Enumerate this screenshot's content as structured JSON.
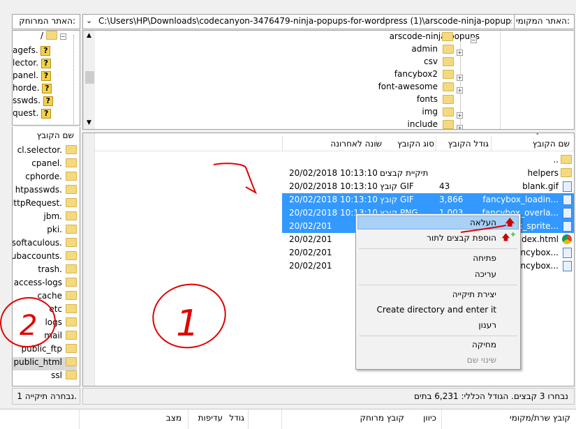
{
  "left_pathbar": {
    "label": "האתר המרוחק:"
  },
  "right_pathbar": {
    "label": "האתר המקומי:",
    "path": "C:\\Users\\HP\\Downloads\\codecanyon-3476479-ninja-popups-for-wordpress (1)\\arscode-ninja-popups\\fancybo",
    "dropdown_icon": "chevron-down-icon"
  },
  "remote_tree": {
    "root": "/",
    "items": [
      "agefs.",
      "lector.",
      "panel.",
      "horde.",
      "sswds.",
      "quest."
    ]
  },
  "local_tree": {
    "items": [
      "arscode-ninja-popups",
      "admin",
      "csv",
      "fancybox2",
      "font-awesome",
      "fonts",
      "img",
      "include"
    ]
  },
  "remote_list": {
    "header": "שם הקובץ",
    "items": [
      "cl.selector.",
      "cpanel.",
      "cphorde.",
      "htpasswds.",
      "HttpRequest.",
      "jbm.",
      "pki.",
      "softaculous.",
      "subaccounts.",
      "trash.",
      "access-logs",
      "cache",
      "etc",
      "logs",
      "mail",
      "public_ftp",
      "public_html",
      "ssl"
    ],
    "status": "נבחרה תיקייה 1."
  },
  "local_list": {
    "headers": {
      "name": "שם הקובץ",
      "size": "גודל הקובץ",
      "type": "סוג הקובץ",
      "modified": "שונה לאחרונה"
    },
    "rows": [
      {
        "name": "..",
        "size": "",
        "type": "",
        "modified": ""
      },
      {
        "name": "helpers",
        "size": "",
        "type": "תיקיית קבצים",
        "modified": "20/02/2018 10:13:10"
      },
      {
        "name": "blank.gif",
        "size": "43",
        "type": "קובץ GIF",
        "modified": "20/02/2018 10:13:10"
      },
      {
        "name": "fancybox_loadin...",
        "size": "3,866",
        "type": "קובץ GIF",
        "modified": "20/02/2018 10:13:10"
      },
      {
        "name": "fancybox_overla...",
        "size": "1,003",
        "type": "קובץ PNG",
        "modified": "20/02/2018 10:13:10"
      },
      {
        "name": "fancybox_sprite...",
        "size": "",
        "type": "",
        "modified": "20/02/201"
      },
      {
        "name": "index.html",
        "size": "",
        "type": "",
        "modified": "20/02/201"
      },
      {
        "name": "jquery.fancybox...",
        "size": "",
        "type": "",
        "modified": "20/02/201"
      },
      {
        "name": "jquery.fancybox...",
        "size": "",
        "type": "",
        "modified": "20/02/201"
      }
    ],
    "status": "נבחרו 3 קבצים. הגודל הכללי: 6,231 בתים"
  },
  "context_menu": {
    "items": [
      "העלאה",
      "הוספת קבצים לתור",
      "פתיחה",
      "עריכה",
      "יצירת תיקייה",
      "Create directory and enter it",
      "רענון",
      "מחיקה",
      "שינוי שם"
    ]
  },
  "queue_header": {
    "cols": [
      "קובץ שרת/מקומי",
      "כיוון",
      "קובץ מרוחק",
      "גודל",
      "עדיפות",
      "מצב"
    ]
  },
  "annotations": {
    "one": "1",
    "two": "2"
  },
  "colors": {
    "selection": "#3399ff",
    "annotation": "#e00000"
  }
}
